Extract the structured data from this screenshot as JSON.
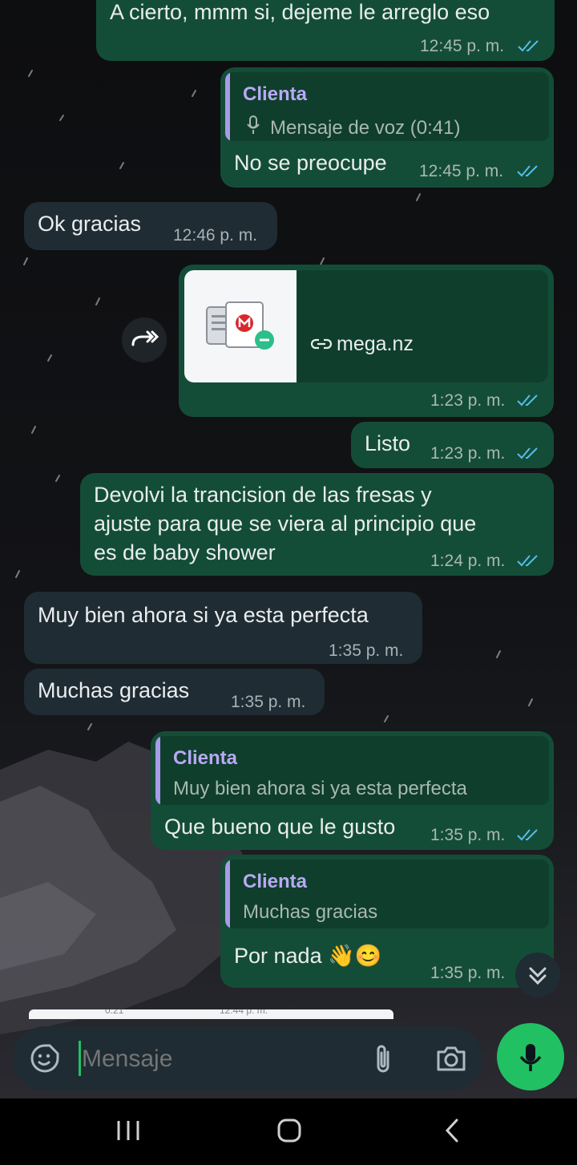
{
  "messages": [
    {
      "text": "A cierto, mmm si, dejeme le arreglo eso",
      "time": "12:45 p. m."
    },
    {
      "quote_name": "Clienta",
      "quote_text": "Mensaje de voz (0:41)",
      "text": "No se preocupe",
      "time": "12:45 p. m."
    },
    {
      "text": "Ok gracias",
      "time": "12:46 p. m."
    },
    {
      "link_text": "mega.nz",
      "time": "1:23 p. m."
    },
    {
      "text": "Listo",
      "time": "1:23 p. m."
    },
    {
      "line1": "Devolvi la trancision de las fresas y",
      "line2": "ajuste para que se viera al principio que",
      "line3": "es de baby shower",
      "time": "1:24 p. m."
    },
    {
      "text": "Muy bien ahora si ya esta perfecta",
      "time": "1:35 p. m."
    },
    {
      "text": "Muchas gracias",
      "time": "1:35 p. m."
    },
    {
      "quote_name": "Clienta",
      "quote_text": "Muy bien ahora si ya esta perfecta",
      "text": "Que bueno que le gusto",
      "time": "1:35 p. m."
    },
    {
      "quote_name": "Clienta",
      "quote_text": "Muchas gracias",
      "text": "Por nada 👋😊",
      "time": "1:35 p. m."
    }
  ],
  "partial_preview": {
    "left": "0:21",
    "right": "12:44 p. m."
  },
  "input": {
    "placeholder": "Mensaje"
  },
  "icons": {
    "emoji": "sticker-emoji-icon",
    "attach": "paperclip-icon",
    "camera": "camera-icon",
    "mic": "microphone-icon",
    "forward": "forward-icon",
    "scroll": "scroll-down-icon",
    "link": "link-icon"
  },
  "colors": {
    "outgoing": "#144d37",
    "incoming": "#202c33",
    "accent": "#21c063",
    "tick": "#53bdeb"
  }
}
